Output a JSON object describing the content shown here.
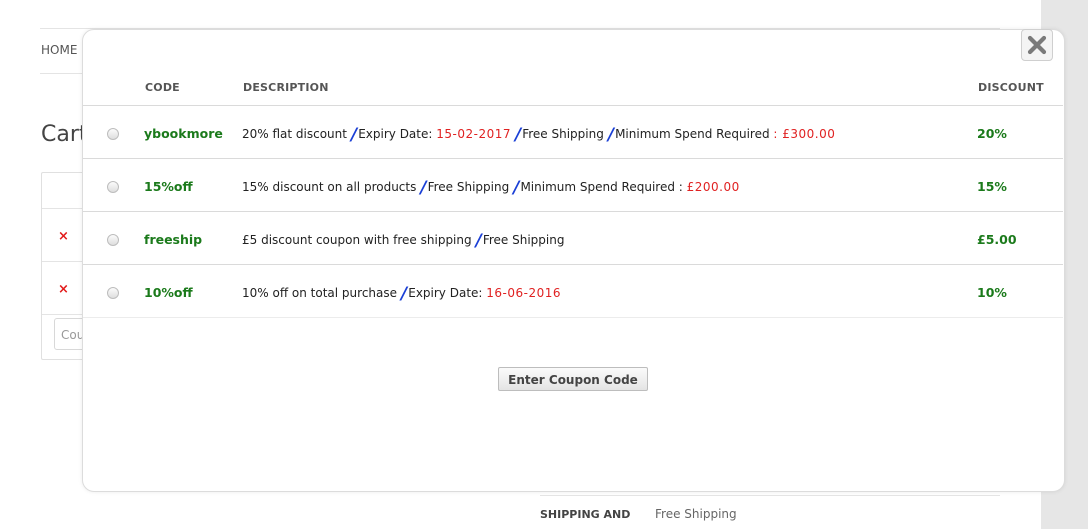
{
  "background": {
    "breadcrumb": "HOME",
    "cart_title": "Cart",
    "remove_symbol": "×",
    "coupon_placeholder": "Cou",
    "shipping_label": "SHIPPING AND",
    "shipping_value": "Free Shipping"
  },
  "modal": {
    "close_icon": "close-icon",
    "columns": {
      "code": "CODE",
      "description": "DESCRIPTION",
      "discount": "DISCOUNT"
    },
    "coupons": [
      {
        "code": "ybookmore",
        "description": "20% flat discount",
        "expiry_label": "Expiry Date:",
        "expiry_date": "15-02-2017",
        "shipping": "Free Shipping",
        "min_spend_label": "Minimum Spend Required",
        "min_spend_value": ": £300.00",
        "discount": "20%"
      },
      {
        "code": "15%off",
        "description": "15% discount on all products",
        "shipping": "Free Shipping",
        "min_spend_label": "Minimum Spend Required",
        "min_spend_value": "£200.00",
        "discount": "15%"
      },
      {
        "code": "freeship",
        "description": "£5 discount coupon with free shipping",
        "shipping": "Free Shipping",
        "discount": "£5.00"
      },
      {
        "code": "10%off",
        "description": "10% off on total purchase",
        "expiry_label": "Expiry Date:",
        "expiry_date": "16-06-2016",
        "discount": "10%"
      }
    ],
    "separator": "/",
    "enter_button": "Enter Coupon Code"
  },
  "colors": {
    "code_green": "#1b7a1b",
    "value_red": "#e02222",
    "separator_blue": "#1a3fd6"
  }
}
